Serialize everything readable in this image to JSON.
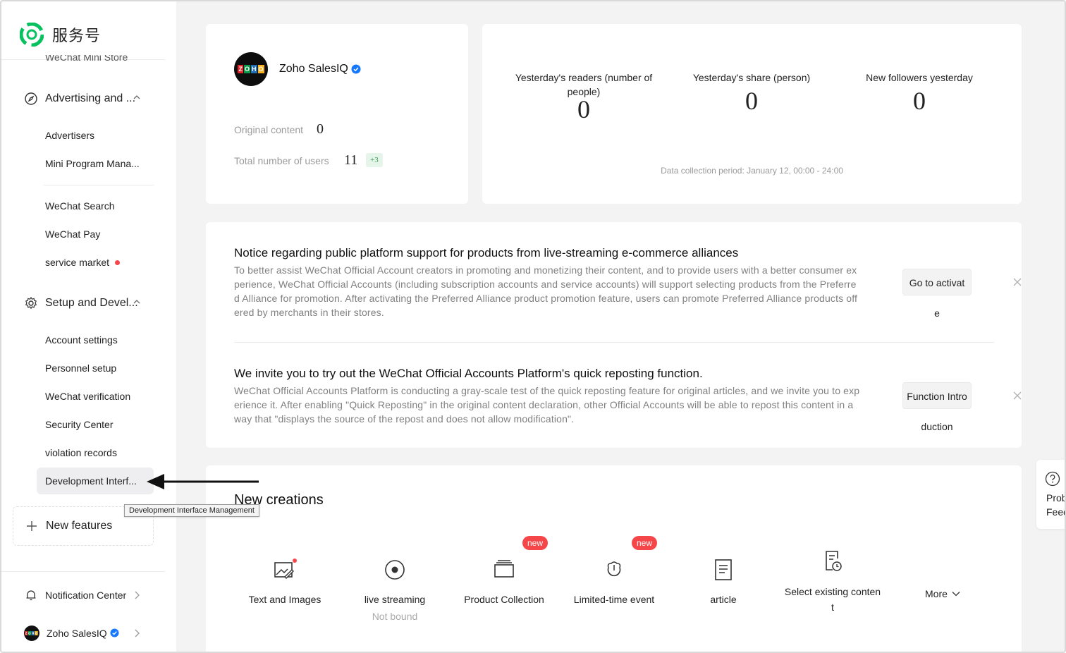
{
  "brand": {
    "name": "服务号"
  },
  "sidebar": {
    "cut_item": "WeChat Mini Store",
    "groups": {
      "advertising": "Advertising and ...",
      "setup": "Setup and Devel..."
    },
    "advertising_items": [
      "Advertisers",
      "Mini Program Mana..."
    ],
    "other_items": [
      "WeChat Search",
      "WeChat Pay",
      "service market"
    ],
    "setup_items": [
      "Account settings",
      "Personnel setup",
      "WeChat verification",
      "Security Center",
      "violation records",
      "Development Interf..."
    ],
    "tooltip": "Development Interface Management",
    "new_features": "New features",
    "notification_center": "Notification Center",
    "account_name": "Zoho SalesIQ"
  },
  "profile": {
    "name": "Zoho SalesIQ",
    "original_content_label": "Original content",
    "original_content_value": "0",
    "total_users_label": "Total number of users",
    "total_users_value": "11",
    "users_delta": "+3"
  },
  "stats": {
    "items": [
      {
        "label": "Yesterday's readers (number of people)",
        "value": "0"
      },
      {
        "label": "Yesterday's share (person)",
        "value": "0"
      },
      {
        "label": "New followers yesterday",
        "value": "0"
      }
    ],
    "period": "Data collection period: January 12, 00:00 - 24:00"
  },
  "notices": [
    {
      "title": "Notice regarding public platform support for products from live-streaming e-commerce alliances",
      "body": "To better assist WeChat Official Account creators in promoting and monetizing their content, and to provide users with a better consumer experience, WeChat Official Accounts (including subscription accounts and service accounts) will support selecting products from the Preferred Alliance for promotion. After activating the Preferred Alliance product promotion feature, users can promote Preferred Alliance products offered by merchants in their stores.",
      "button_line1": "Go to activat",
      "button_line2": "e"
    },
    {
      "title": "We invite you to try out the WeChat Official Accounts Platform's quick reposting function.",
      "body": "WeChat Official Accounts Platform is conducting a gray-scale test of the quick reposting feature for original articles, and we invite you to experience it. After enabling \"Quick Reposting\" in the original content declaration, other Official Accounts will be able to repost this content in a way that \"displays the source of the repost and does not allow modification\".",
      "button_line1": "Function Intro",
      "button_line2": "duction"
    }
  ],
  "creations": {
    "title": "New creations",
    "items": [
      {
        "label": "Text and Images",
        "icon": "image-edit-icon"
      },
      {
        "label": "live streaming",
        "sub": "Not bound",
        "icon": "live-icon"
      },
      {
        "label": "Product Collection",
        "badge": "new",
        "icon": "collection-icon"
      },
      {
        "label": "Limited-time event",
        "badge": "new",
        "icon": "event-icon"
      },
      {
        "label": "article",
        "icon": "article-icon"
      },
      {
        "label_line1": "Select existing conten",
        "label_line2": "t",
        "icon": "select-content-icon"
      }
    ],
    "more": "More"
  },
  "feedback": {
    "line1": "Prob",
    "line2": "Feed"
  },
  "colors": {
    "accent_green": "#07c160",
    "red": "#f5474a",
    "verified_blue": "#1677ff"
  }
}
